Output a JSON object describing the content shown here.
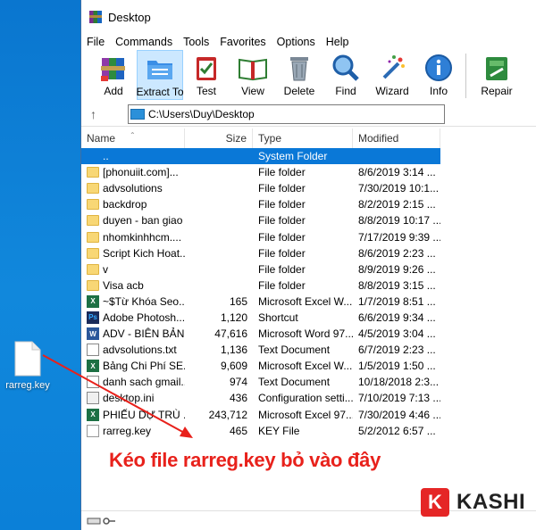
{
  "desktop": {
    "icon_label": "rarreg.key",
    "background_color": "#0d7fd6"
  },
  "window": {
    "title": "Desktop",
    "menu": [
      "File",
      "Commands",
      "Tools",
      "Favorites",
      "Options",
      "Help"
    ],
    "toolbar": [
      {
        "label": "Add",
        "icon": "add-archive-icon"
      },
      {
        "label": "Extract To",
        "icon": "extract-folder-icon",
        "active": true
      },
      {
        "label": "Test",
        "icon": "test-clipboard-icon"
      },
      {
        "label": "View",
        "icon": "view-book-icon"
      },
      {
        "label": "Delete",
        "icon": "trash-icon"
      },
      {
        "label": "Find",
        "icon": "magnifier-icon"
      },
      {
        "label": "Wizard",
        "icon": "magic-wand-icon"
      },
      {
        "label": "Info",
        "icon": "info-icon"
      },
      {
        "label": "Repair",
        "icon": "repair-kit-icon"
      }
    ],
    "address": "C:\\Users\\Duy\\Desktop",
    "columns": {
      "name": "Name",
      "size": "Size",
      "type": "Type",
      "modified": "Modified"
    },
    "files": [
      {
        "name": "..",
        "size": "",
        "type": "System Folder",
        "modified": "",
        "icon": "up",
        "selected": true
      },
      {
        "name": "[phonuiit.com]...",
        "size": "",
        "type": "File folder",
        "modified": "8/6/2019 3:14 ...",
        "icon": "folder"
      },
      {
        "name": "advsolutions",
        "size": "",
        "type": "File folder",
        "modified": "7/30/2019 10:1...",
        "icon": "folder"
      },
      {
        "name": "backdrop",
        "size": "",
        "type": "File folder",
        "modified": "8/2/2019 2:15 ...",
        "icon": "folder"
      },
      {
        "name": "duyen - ban giao",
        "size": "",
        "type": "File folder",
        "modified": "8/8/2019 10:17 ...",
        "icon": "folder"
      },
      {
        "name": "nhomkinhhcm....",
        "size": "",
        "type": "File folder",
        "modified": "7/17/2019 9:39 ...",
        "icon": "folder"
      },
      {
        "name": "Script Kich Hoat...",
        "size": "",
        "type": "File folder",
        "modified": "8/6/2019 2:23 ...",
        "icon": "folder"
      },
      {
        "name": "v",
        "size": "",
        "type": "File folder",
        "modified": "8/9/2019 9:26 ...",
        "icon": "folder"
      },
      {
        "name": "Visa acb",
        "size": "",
        "type": "File folder",
        "modified": "8/8/2019 3:15 ...",
        "icon": "folder"
      },
      {
        "name": "~$Từ Khóa Seo....",
        "size": "165",
        "type": "Microsoft Excel W...",
        "modified": "1/7/2019 8:51 ...",
        "icon": "excel"
      },
      {
        "name": "Adobe Photosh...",
        "size": "1,120",
        "type": "Shortcut",
        "modified": "6/6/2019 9:34 ...",
        "icon": "ps"
      },
      {
        "name": "ADV - BIÊN BẢN...",
        "size": "47,616",
        "type": "Microsoft Word 97...",
        "modified": "4/5/2019 3:04 ...",
        "icon": "word"
      },
      {
        "name": "advsolutions.txt",
        "size": "1,136",
        "type": "Text Document",
        "modified": "6/7/2019 2:23 ...",
        "icon": "txt"
      },
      {
        "name": "Bảng Chi Phí SE...",
        "size": "9,609",
        "type": "Microsoft Excel W...",
        "modified": "1/5/2019 1:50 ...",
        "icon": "excel"
      },
      {
        "name": "danh sach gmail...",
        "size": "974",
        "type": "Text Document",
        "modified": "10/18/2018 2:3...",
        "icon": "txt"
      },
      {
        "name": "desktop.ini",
        "size": "436",
        "type": "Configuration setti...",
        "modified": "7/10/2019 7:13 ...",
        "icon": "ini"
      },
      {
        "name": "PHIẾU DỰ TRÙ ...",
        "size": "243,712",
        "type": "Microsoft Excel 97...",
        "modified": "7/30/2019 4:46 ...",
        "icon": "excel"
      },
      {
        "name": "rarreg.key",
        "size": "465",
        "type": "KEY File",
        "modified": "5/2/2012 6:57 ...",
        "icon": "key"
      }
    ]
  },
  "annotation": {
    "text": "Kéo file rarreg.key bỏ vào đây",
    "color": "#e8211b"
  },
  "brand": {
    "logo_letter": "K",
    "name": "KASHI",
    "color": "#e52626"
  }
}
